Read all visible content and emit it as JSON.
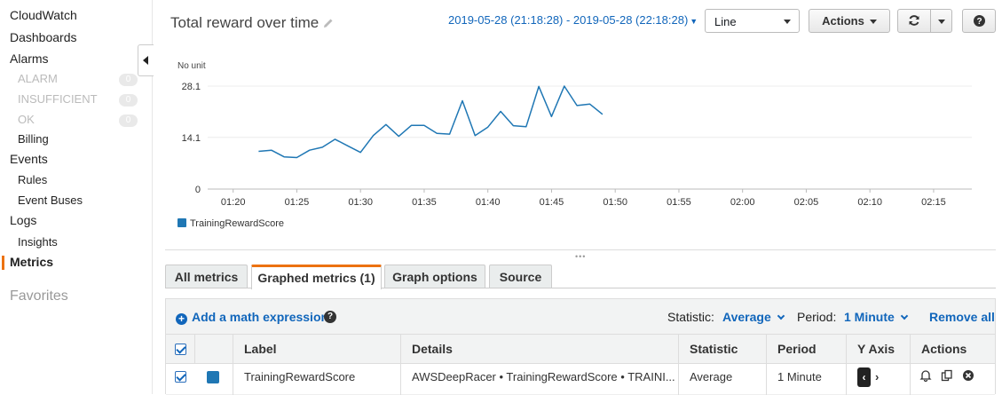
{
  "sidebar": {
    "items": [
      {
        "label": "CloudWatch"
      },
      {
        "label": "Dashboards"
      },
      {
        "label": "Alarms"
      },
      {
        "label": "ALARM",
        "count": "0"
      },
      {
        "label": "INSUFFICIENT",
        "count": "0"
      },
      {
        "label": "OK",
        "count": "0"
      },
      {
        "label": "Billing"
      },
      {
        "label": "Events"
      },
      {
        "label": "Rules"
      },
      {
        "label": "Event Buses"
      },
      {
        "label": "Logs"
      },
      {
        "label": "Insights"
      },
      {
        "label": "Metrics",
        "active": true
      }
    ],
    "favorites": "Favorites",
    "active_color": "#ec7211"
  },
  "header": {
    "title": "Total reward over time",
    "date_range": "2019-05-28 (21:18:28) - 2019-05-28 (22:18:28)",
    "chart_type": "Line",
    "actions_label": "Actions",
    "icons": [
      "pencil-icon",
      "refresh-icon",
      "question-icon"
    ]
  },
  "chart_data": {
    "type": "line",
    "unit_label": "No unit",
    "x_ticks": [
      "01:20",
      "01:25",
      "01:30",
      "01:35",
      "01:40",
      "01:45",
      "01:50",
      "01:55",
      "02:00",
      "02:05",
      "02:10",
      "02:15"
    ],
    "y_ticks": [
      "0",
      "14.1",
      "28.1"
    ],
    "ylim": [
      0,
      28.1
    ],
    "xlim": [
      "01:18",
      "02:18"
    ],
    "grid": true,
    "legend_position": "bottom-left",
    "series": [
      {
        "name": "TrainingRewardScore",
        "color": "#1f77b4",
        "x": [
          "01:22",
          "01:23",
          "01:24",
          "01:25",
          "01:26",
          "01:27",
          "01:28",
          "01:29",
          "01:30",
          "01:31",
          "01:32",
          "01:33",
          "01:34",
          "01:35",
          "01:36",
          "01:37",
          "01:38",
          "01:39",
          "01:40",
          "01:41",
          "01:42",
          "01:43",
          "01:44",
          "01:45",
          "01:46",
          "01:47",
          "01:48",
          "01:49"
        ],
        "values": [
          10.3,
          10.6,
          8.8,
          8.6,
          10.6,
          11.4,
          13.6,
          11.8,
          10.0,
          14.6,
          17.6,
          14.4,
          17.4,
          17.4,
          15.2,
          15.0,
          24.1,
          14.6,
          16.9,
          21.2,
          17.3,
          17.0,
          28.0,
          19.8,
          28.1,
          22.8,
          23.2,
          20.4
        ]
      }
    ]
  },
  "tabs": [
    {
      "label": "All metrics"
    },
    {
      "label": "Graphed metrics (1)",
      "active": true
    },
    {
      "label": "Graph options"
    },
    {
      "label": "Source"
    }
  ],
  "toolbar": {
    "add_math": "Add a math expression",
    "statistic_label": "Statistic:",
    "statistic_value": "Average",
    "period_label": "Period:",
    "period_value": "1 Minute",
    "remove_all": "Remove all"
  },
  "table": {
    "columns": [
      "Label",
      "Details",
      "Statistic",
      "Period",
      "Y Axis",
      "Actions"
    ],
    "rows": [
      {
        "checked": true,
        "color": "#1f77b4",
        "label": "TrainingRewardScore",
        "details": "AWSDeepRacer • TrainingRewardScore • TRAINI...",
        "statistic": "Average",
        "period": "1 Minute",
        "y_axis": "left"
      }
    ]
  }
}
